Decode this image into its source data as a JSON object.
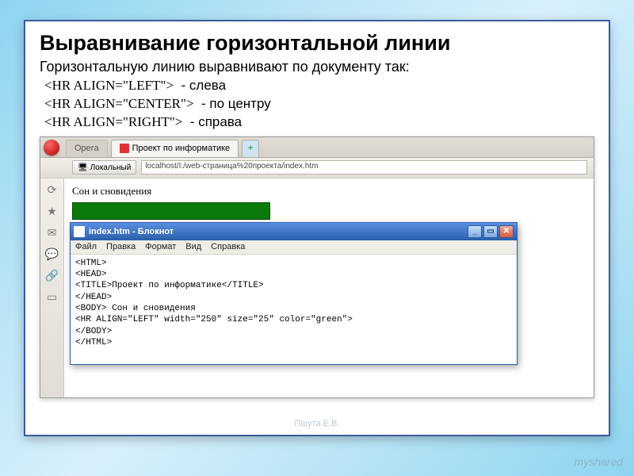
{
  "slide": {
    "title": "Выравнивание горизонтальной линии",
    "intro": "Горизонтальную линию выравнивают по документу так:",
    "aligns": [
      {
        "tag": "<HR ALIGN=\"LEFT\">",
        "desc": "- слева"
      },
      {
        "tag": "<HR ALIGN=\"CENTER\">",
        "desc": "- по центру"
      },
      {
        "tag": "<HR ALIGN=\"RIGHT\">",
        "desc": "- справа"
      }
    ],
    "footer_credit": "Пшута Е.В."
  },
  "browser": {
    "tabs": {
      "inactive": "Opera",
      "active": "Проект по информатике"
    },
    "local_button": "Локальный",
    "url": "localhost/I:/web-страница%20проекта/index.htm",
    "page_heading": "Сон и сновидения"
  },
  "notepad": {
    "title": "index.htm - Блокнот",
    "menu": [
      "Файл",
      "Правка",
      "Формат",
      "Вид",
      "Справка"
    ],
    "code": "<HTML>\n<HEAD>\n<TITLE>Проект по информатике</TITLE>\n</HEAD>\n<BODY> Сон и сновидения\n<HR ALIGN=\"LEFT\" width=\"250\" size=\"25\" color=\"green\">\n</BODY>\n</HTML>"
  },
  "watermark": "myshared"
}
